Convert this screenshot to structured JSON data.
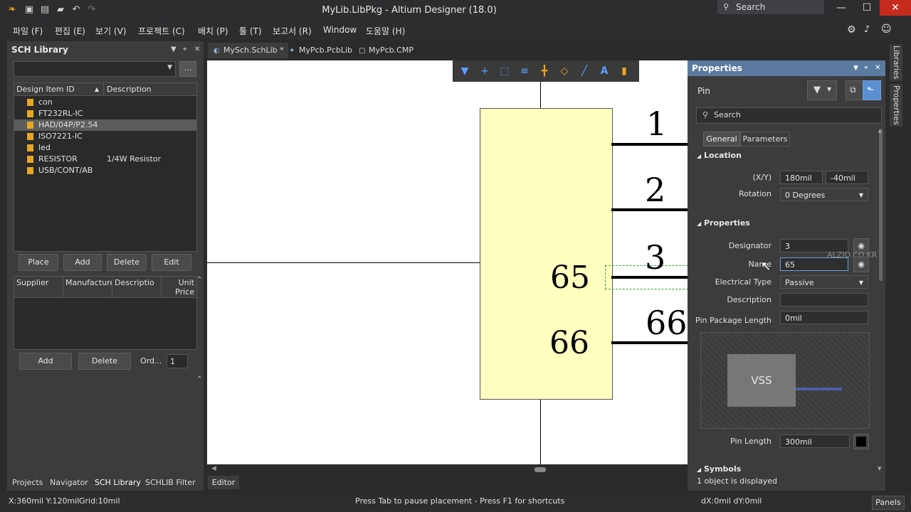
{
  "window": {
    "title": "MyLib.LibPkg - Altium Designer (18.0)",
    "search_placeholder": "Search",
    "minimize": "—",
    "maximize": "☐",
    "close": "✕"
  },
  "menu": [
    "파일 (F)",
    "편집 (E)",
    "보기 (V)",
    "프로젝트 (C)",
    "배치 (P)",
    "툴 (T)",
    "보고서 (R)",
    "Window",
    "도움말 (H)"
  ],
  "left_panel": {
    "title": "SCH Library",
    "library_combo_value": "",
    "more_button": "...",
    "columns": [
      "Design Item ID",
      "Description"
    ],
    "items": [
      {
        "id": "con",
        "description": ""
      },
      {
        "id": "FT232RL-IC",
        "description": ""
      },
      {
        "id": "HAD/04P/P2.54",
        "description": ""
      },
      {
        "id": "ISO7221-IC",
        "description": ""
      },
      {
        "id": "led",
        "description": ""
      },
      {
        "id": "RESISTOR",
        "description": "1/4W Resistor"
      },
      {
        "id": "USB/CONT/AB",
        "description": ""
      }
    ],
    "selected_item": "HAD/04P/P2.54",
    "buttons": {
      "place": "Place",
      "add": "Add",
      "delete": "Delete",
      "edit": "Edit"
    },
    "supplier_columns": [
      "Supplier",
      "Manufacture",
      "Descriptio",
      "Unit Price"
    ],
    "supplier_buttons": {
      "add": "Add",
      "delete": "Delete"
    },
    "order_label": "Ord...",
    "order_value": "1"
  },
  "panel_tabs": [
    "Projects",
    "Navigator",
    "SCH Library",
    "SCHLIB Filter"
  ],
  "active_panel_tab": "SCH Library",
  "doc_tabs": [
    {
      "label": "MySch.SchLib *",
      "active": true
    },
    {
      "label": "MyPcb.PcbLib",
      "active": false
    },
    {
      "label": "MyPcb.CMP",
      "active": false
    }
  ],
  "schematic": {
    "pin_numbers": [
      "1",
      "2",
      "3",
      "66"
    ],
    "pin_names": [
      "65",
      "66"
    ]
  },
  "editor_tab": "Editor",
  "properties": {
    "title": "Properties",
    "object_type": "Pin",
    "search_placeholder": "Search",
    "tabs": [
      "General",
      "Parameters"
    ],
    "location_section": "Location",
    "xy_label": "(X/Y)",
    "x_value": "180mil",
    "y_value": "-40mil",
    "rotation_label": "Rotation",
    "rotation_value": "0 Degrees",
    "properties_section": "Properties",
    "designator_label": "Designator",
    "designator_value": "3",
    "name_label": "Name",
    "name_value": "65",
    "electrical_type_label": "Electrical Type",
    "electrical_type_value": "Passive",
    "description_label": "Description",
    "description_value": "",
    "pin_package_length_label": "Pin Package Length",
    "pin_package_length_value": "0mil",
    "preview_label": "VSS",
    "pin_length_label": "Pin Length",
    "pin_length_value": "300mil",
    "symbols_section": "Symbols",
    "status": "1 object is displayed",
    "watermark": "ALZIO.CO.KR"
  },
  "side_tabs": [
    "Libraries",
    "Properties"
  ],
  "status_bar": {
    "coords": "X:360mil Y:120mil",
    "grid": "Grid:10mil",
    "message": "Press Tab to pause placement - Press F1 for shortcuts",
    "delta": "dX:0mil dY:0mil",
    "panels_button": "Panels"
  },
  "colors": {
    "accent": "#5a7aa0",
    "part_body": "#ffffc0",
    "library_icon": "#e8a623"
  }
}
